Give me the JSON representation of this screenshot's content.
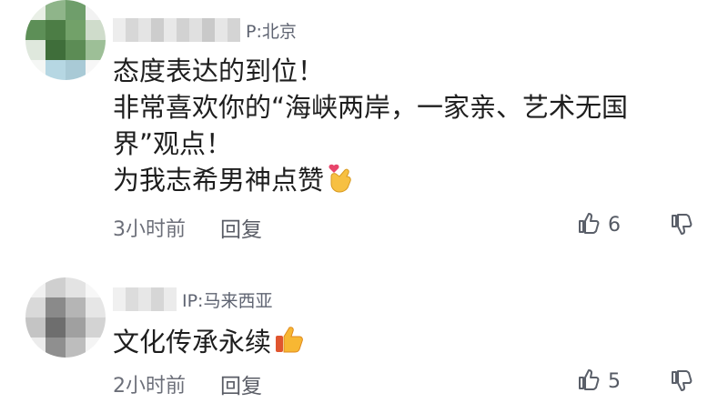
{
  "comments": [
    {
      "ip_label": "P:北京",
      "lines": [
        "态度表达的到位！",
        "非常喜欢你的“海峡两岸，一家亲、艺术无国",
        "界”观点！",
        "为我志希男神点赞"
      ],
      "emoji": "finger-heart-icon",
      "time": "3小时前",
      "reply_label": "回复",
      "like_count": "6"
    },
    {
      "ip_label": "IP:马来西亚",
      "lines": [
        "文化传承永续"
      ],
      "emoji": "thumbs-up-emoji-icon",
      "time": "2小时前",
      "reply_label": "回复",
      "like_count": "5"
    }
  ]
}
